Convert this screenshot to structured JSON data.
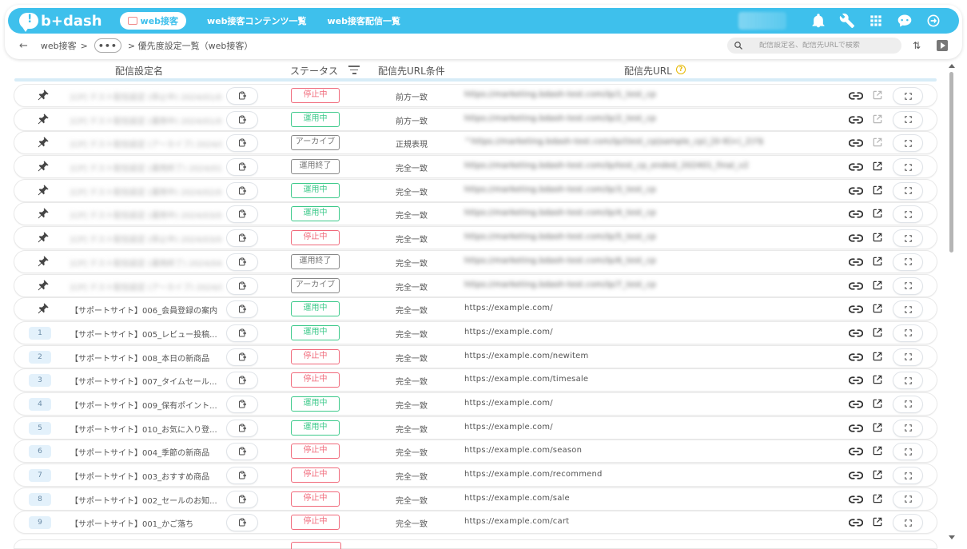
{
  "app": {
    "logo_text": "b+dash",
    "nav_active": "web接客",
    "nav_links": [
      "web接客コンテンツ一覧",
      "web接客配信一覧"
    ]
  },
  "topbar_icons": [
    "bell-icon",
    "wrench-icon",
    "grid-icon",
    "chat-bot-icon",
    "logout-icon"
  ],
  "breadcrumb": {
    "root": "web接客",
    "separator": ">",
    "ellipsis": "•••",
    "current": "> 優先度設定一覧（web接客）"
  },
  "search": {
    "placeholder": "配信設定名、配信先URLで検索"
  },
  "table": {
    "headers": {
      "name": "配信設定名",
      "status": "ステータス",
      "condition": "配信先URL条件",
      "url": "配信先URL"
    },
    "rows": [
      {
        "lead": "pin",
        "num": "",
        "name": "[CP] テスト配信設定 (停止中) 2024/01/01",
        "blurred": true,
        "status": "停止中",
        "status_type": "stop",
        "cond": "前方一致",
        "url": "https://marketing.bdash-test.com/lp/1_test_cp",
        "ext_dim": true
      },
      {
        "lead": "pin",
        "num": "",
        "name": "[CP] テスト配信設定 (運用中) 2024/01/01",
        "blurred": true,
        "status": "運用中",
        "status_type": "run",
        "cond": "前方一致",
        "url": "https://marketing.bdash-test.com/lp/2_test_cp",
        "ext_dim": true
      },
      {
        "lead": "pin",
        "num": "",
        "name": "[CP] テスト配信設定 (アーカイブ) 2024/01/01",
        "blurred": true,
        "status": "アーカイブ",
        "status_type": "arc",
        "cond": "正規表現",
        "url": "^https://marketing.bdash-test.com/lp/(test_cp|sample_cp)_[0-9]+(_2)?$",
        "ext_dim": true
      },
      {
        "lead": "pin",
        "num": "",
        "name": "[CP] テスト配信設定 (運用終了) 2024/01/01",
        "blurred": true,
        "status": "運用終了",
        "status_type": "arc",
        "cond": "完全一致",
        "url": "https://marketing.bdash-test.com/lp/test_cp_ended_202401_final_v2",
        "ext_dim": false
      },
      {
        "lead": "pin",
        "num": "",
        "name": "[CP] テスト配信設定 (運用中) 2024/02/01",
        "blurred": true,
        "status": "運用中",
        "status_type": "run",
        "cond": "完全一致",
        "url": "https://marketing.bdash-test.com/lp/3_test_cp",
        "ext_dim": false
      },
      {
        "lead": "pin",
        "num": "",
        "name": "[CP] テスト配信設定 (運用中) 2024/03/01",
        "blurred": true,
        "status": "運用中",
        "status_type": "run",
        "cond": "完全一致",
        "url": "https://marketing.bdash-test.com/lp/4_test_cp",
        "ext_dim": false
      },
      {
        "lead": "pin",
        "num": "",
        "name": "[CP] テスト配信設定 (停止中) 2024/03/01",
        "blurred": true,
        "status": "停止中",
        "status_type": "stop",
        "cond": "完全一致",
        "url": "https://marketing.bdash-test.com/lp/5_test_cp",
        "ext_dim": false
      },
      {
        "lead": "pin",
        "num": "",
        "name": "[CP] テスト配信設定 (運用終了) 2024/04/01",
        "blurred": true,
        "status": "運用終了",
        "status_type": "arc",
        "cond": "完全一致",
        "url": "https://marketing.bdash-test.com/lp/6_test_cp",
        "ext_dim": false
      },
      {
        "lead": "pin",
        "num": "",
        "name": "[CP] テスト配信設定 (アーカイブ) 2024/04/01",
        "blurred": true,
        "status": "アーカイブ",
        "status_type": "arc",
        "cond": "完全一致",
        "url": "https://marketing.bdash-test.com/lp/7_test_cp",
        "ext_dim": false
      },
      {
        "lead": "pin",
        "num": "",
        "name": "【サポートサイト】006_会員登録の案内",
        "blurred": false,
        "status": "運用中",
        "status_type": "run",
        "cond": "完全一致",
        "url": "https://example.com/",
        "ext_dim": false
      },
      {
        "lead": "num",
        "num": "1",
        "name": "【サポートサイト】005_レビュー投稿...",
        "blurred": false,
        "status": "運用中",
        "status_type": "run",
        "cond": "完全一致",
        "url": "https://example.com/",
        "ext_dim": false
      },
      {
        "lead": "num",
        "num": "2",
        "name": "【サポートサイト】008_本日の新商品",
        "blurred": false,
        "status": "停止中",
        "status_type": "stop",
        "cond": "完全一致",
        "url": "https://example.com/newitem",
        "ext_dim": false
      },
      {
        "lead": "num",
        "num": "3",
        "name": "【サポートサイト】007_タイムセール...",
        "blurred": false,
        "status": "停止中",
        "status_type": "stop",
        "cond": "完全一致",
        "url": "https://example.com/timesale",
        "ext_dim": false
      },
      {
        "lead": "num",
        "num": "4",
        "name": "【サポートサイト】009_保有ポイント...",
        "blurred": false,
        "status": "運用中",
        "status_type": "run",
        "cond": "完全一致",
        "url": "https://example.com/",
        "ext_dim": false
      },
      {
        "lead": "num",
        "num": "5",
        "name": "【サポートサイト】010_お気に入り登...",
        "blurred": false,
        "status": "運用中",
        "status_type": "run",
        "cond": "完全一致",
        "url": "https://example.com/",
        "ext_dim": false
      },
      {
        "lead": "num",
        "num": "6",
        "name": "【サポートサイト】004_季節の新商品",
        "blurred": false,
        "status": "停止中",
        "status_type": "stop",
        "cond": "完全一致",
        "url": "https://example.com/season",
        "ext_dim": false
      },
      {
        "lead": "num",
        "num": "7",
        "name": "【サポートサイト】003_おすすめ商品",
        "blurred": false,
        "status": "停止中",
        "status_type": "stop",
        "cond": "完全一致",
        "url": "https://example.com/recommend",
        "ext_dim": false
      },
      {
        "lead": "num",
        "num": "8",
        "name": "【サポートサイト】002_セールのお知...",
        "blurred": false,
        "status": "停止中",
        "status_type": "stop",
        "cond": "完全一致",
        "url": "https://example.com/sale",
        "ext_dim": false
      },
      {
        "lead": "num",
        "num": "9",
        "name": "【サポートサイト】001_かご落ち",
        "blurred": false,
        "status": "停止中",
        "status_type": "stop",
        "cond": "完全一致",
        "url": "https://example.com/cart",
        "ext_dim": false
      }
    ]
  },
  "colors": {
    "accent": "#3ec0ec",
    "status_stop": "#f0697a",
    "status_run": "#3cc98a",
    "status_archive": "#888888"
  }
}
